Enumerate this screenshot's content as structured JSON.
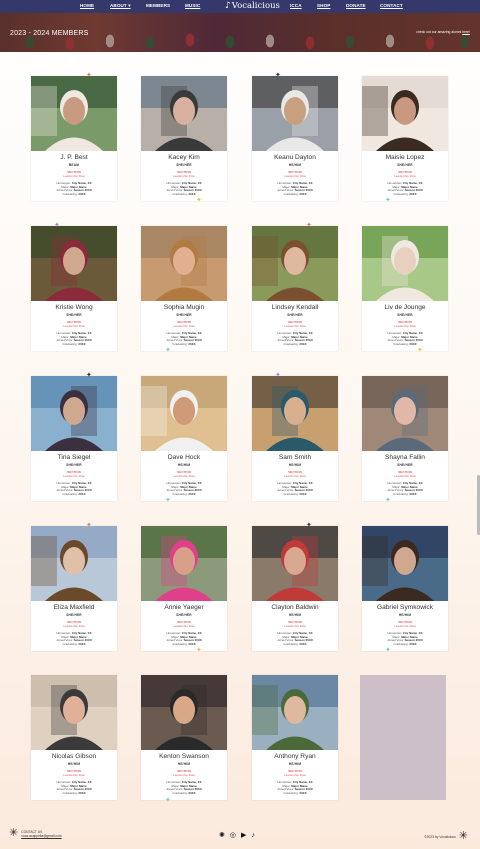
{
  "nav": {
    "links": [
      "HOME",
      "ABOUT ▾",
      "MEMBERS",
      "MUSIC",
      "ICCA",
      "SHOP",
      "DONATE",
      "CONTACT"
    ],
    "logo_text": "Vocalicious"
  },
  "hero": {
    "title": "2023 - 2024 MEMBERS",
    "note_prefix": "check out our amazing alumni ",
    "note_link": "here!"
  },
  "member_labels": {
    "section": "SECTION",
    "position": "Leadership Role",
    "hometown_label": "Hometown:",
    "hometown": "City Name, XX",
    "major_label": "Major:",
    "major": "Major Name",
    "joined_label": "Joined Voca:",
    "joined": "Season 20XX",
    "graduating_label": "Graduating:",
    "graduating": "20XX"
  },
  "members": [
    {
      "name": "J. P. Best",
      "voice": "BEAM",
      "palette": [
        "#3a5a3a",
        "#7a9a6a",
        "#c89a80",
        "#f0e8e0"
      ]
    },
    {
      "name": "Kacey Kim",
      "voice": "SHE/HER",
      "palette": [
        "#6a7a8a",
        "#b8b0a8",
        "#d8b0a0",
        "#3a3a3a"
      ]
    },
    {
      "name": "Keanu Dayton",
      "voice": "HE/HIM",
      "palette": [
        "#4a4a4a",
        "#9aa0a8",
        "#c8a080",
        "#e8e8e8"
      ]
    },
    {
      "name": "Maisie Lopez",
      "voice": "SHE/HER",
      "palette": [
        "#e0d8d0",
        "#f0e8e0",
        "#c89880",
        "#3a2a20"
      ]
    },
    {
      "name": "Kristie Wong",
      "voice": "SHE/HER",
      "palette": [
        "#3a4a2a",
        "#6a5a3a",
        "#d0a890",
        "#8a2a3a"
      ]
    },
    {
      "name": "Sophia Mugin",
      "voice": "SHE/HER",
      "palette": [
        "#a08060",
        "#c89a70",
        "#e0b090",
        "#b07a40"
      ]
    },
    {
      "name": "Lindsey Kendall",
      "voice": "SHE/HER",
      "palette": [
        "#5a6a3a",
        "#8a9a5a",
        "#e0b8a0",
        "#7a5030"
      ]
    },
    {
      "name": "Liv de Jounge",
      "voice": "SHE/HER",
      "palette": [
        "#6a9a4a",
        "#a8c888",
        "#e8d0c0",
        "#f0e8e0"
      ]
    },
    {
      "name": "Tina Siegel",
      "voice": "SHE/HER",
      "palette": [
        "#5a8ab0",
        "#8ab0d0",
        "#d0a890",
        "#3a3040"
      ]
    },
    {
      "name": "Dave Hock",
      "voice": "HE/HIM",
      "palette": [
        "#c0a070",
        "#e0c090",
        "#d09a78",
        "#f0f0f0"
      ]
    },
    {
      "name": "Sam Smith",
      "voice": "HE/HIM",
      "palette": [
        "#5a4a3a",
        "#c8a070",
        "#d8b090",
        "#2a5a6a"
      ]
    },
    {
      "name": "Shayna Fallin",
      "voice": "SHE/HER",
      "palette": [
        "#6a5a50",
        "#a08878",
        "#e0b8a8",
        "#5a6a7a"
      ]
    },
    {
      "name": "Eliza Maxfield",
      "voice": "SHE/HER",
      "palette": [
        "#8aa0c0",
        "#b8c8d8",
        "#e0c0a8",
        "#6a4a2a"
      ]
    },
    {
      "name": "Annie Yaeger",
      "voice": "SHE/HER",
      "palette": [
        "#4a6a3a",
        "#8a9a7a",
        "#d8a088",
        "#e0408a"
      ]
    },
    {
      "name": "Clayton Baldwin",
      "voice": "HE/HIM",
      "palette": [
        "#3a3a3a",
        "#8a7a6a",
        "#d8a890",
        "#c03a3a"
      ]
    },
    {
      "name": "Gabriel Symkowick",
      "voice": "HE/HIM",
      "palette": [
        "#2a3a5a",
        "#4a6a8a",
        "#d0a890",
        "#3a2a20"
      ]
    },
    {
      "name": "Nicolas Gibson",
      "voice": "HE/HIM",
      "palette": [
        "#c8b8a8",
        "#e0d0c0",
        "#e0b098",
        "#3a3a3a"
      ]
    },
    {
      "name": "Kenton Swanson",
      "voice": "HE/HIM",
      "palette": [
        "#3a3030",
        "#6a5a50",
        "#d8a888",
        "#2a2a2a"
      ]
    },
    {
      "name": "Anthony Ryan",
      "voice": "HE/HIM",
      "palette": [
        "#5a7a9a",
        "#9ab0c0",
        "#e0b8a0",
        "#4a6a3a"
      ]
    }
  ],
  "footer": {
    "contact_label": "CONTACT US",
    "contact_email": "voca.acappella@gmail.com",
    "copyright": "©2023 by Vocalicious",
    "social_icons": [
      "spotify-icon",
      "instagram-icon",
      "youtube-icon",
      "tiktok-icon"
    ]
  }
}
